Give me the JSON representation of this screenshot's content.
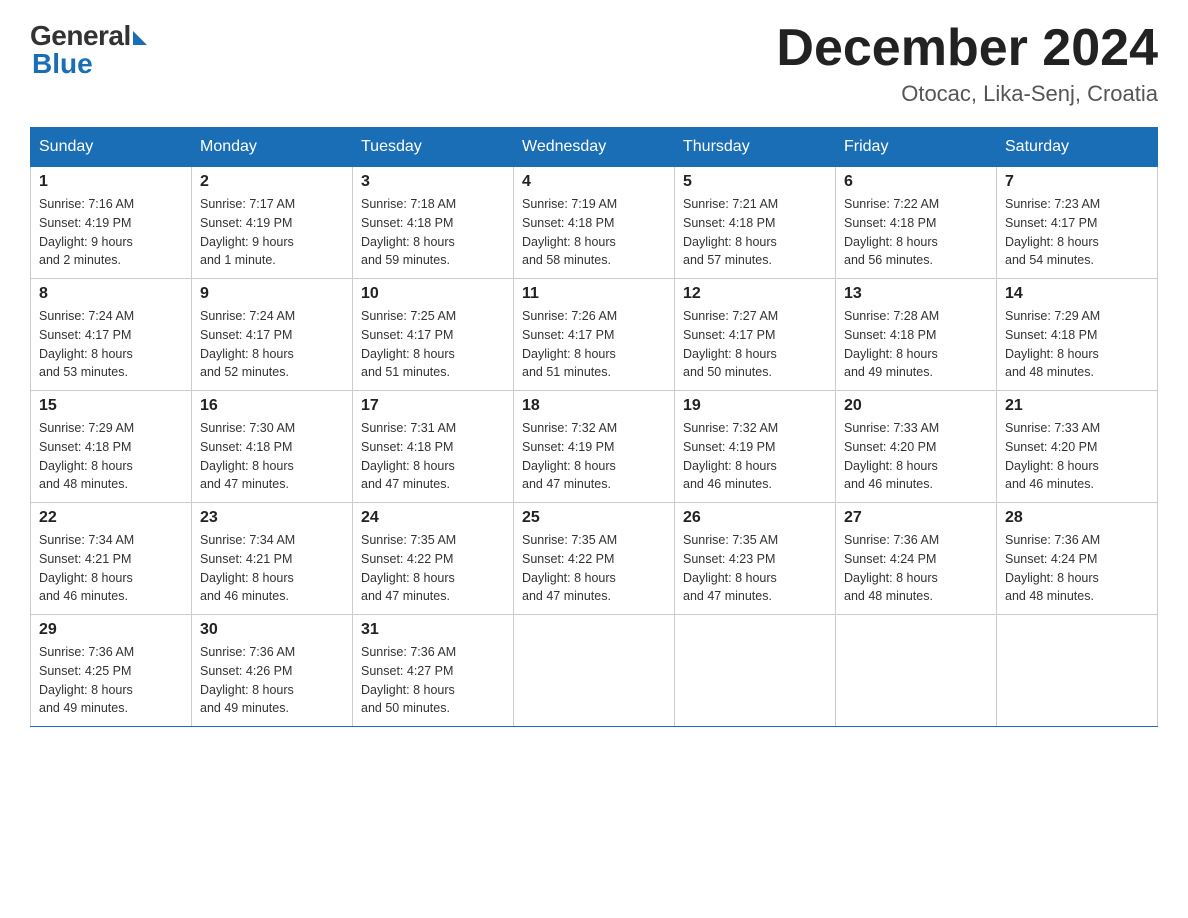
{
  "header": {
    "logo_general": "General",
    "logo_blue": "Blue",
    "title": "December 2024",
    "location": "Otocac, Lika-Senj, Croatia"
  },
  "days_of_week": [
    "Sunday",
    "Monday",
    "Tuesday",
    "Wednesday",
    "Thursday",
    "Friday",
    "Saturday"
  ],
  "weeks": [
    [
      {
        "day": "1",
        "sunrise": "7:16 AM",
        "sunset": "4:19 PM",
        "daylight": "9 hours and 2 minutes."
      },
      {
        "day": "2",
        "sunrise": "7:17 AM",
        "sunset": "4:19 PM",
        "daylight": "9 hours and 1 minute."
      },
      {
        "day": "3",
        "sunrise": "7:18 AM",
        "sunset": "4:18 PM",
        "daylight": "8 hours and 59 minutes."
      },
      {
        "day": "4",
        "sunrise": "7:19 AM",
        "sunset": "4:18 PM",
        "daylight": "8 hours and 58 minutes."
      },
      {
        "day": "5",
        "sunrise": "7:21 AM",
        "sunset": "4:18 PM",
        "daylight": "8 hours and 57 minutes."
      },
      {
        "day": "6",
        "sunrise": "7:22 AM",
        "sunset": "4:18 PM",
        "daylight": "8 hours and 56 minutes."
      },
      {
        "day": "7",
        "sunrise": "7:23 AM",
        "sunset": "4:17 PM",
        "daylight": "8 hours and 54 minutes."
      }
    ],
    [
      {
        "day": "8",
        "sunrise": "7:24 AM",
        "sunset": "4:17 PM",
        "daylight": "8 hours and 53 minutes."
      },
      {
        "day": "9",
        "sunrise": "7:24 AM",
        "sunset": "4:17 PM",
        "daylight": "8 hours and 52 minutes."
      },
      {
        "day": "10",
        "sunrise": "7:25 AM",
        "sunset": "4:17 PM",
        "daylight": "8 hours and 51 minutes."
      },
      {
        "day": "11",
        "sunrise": "7:26 AM",
        "sunset": "4:17 PM",
        "daylight": "8 hours and 51 minutes."
      },
      {
        "day": "12",
        "sunrise": "7:27 AM",
        "sunset": "4:17 PM",
        "daylight": "8 hours and 50 minutes."
      },
      {
        "day": "13",
        "sunrise": "7:28 AM",
        "sunset": "4:18 PM",
        "daylight": "8 hours and 49 minutes."
      },
      {
        "day": "14",
        "sunrise": "7:29 AM",
        "sunset": "4:18 PM",
        "daylight": "8 hours and 48 minutes."
      }
    ],
    [
      {
        "day": "15",
        "sunrise": "7:29 AM",
        "sunset": "4:18 PM",
        "daylight": "8 hours and 48 minutes."
      },
      {
        "day": "16",
        "sunrise": "7:30 AM",
        "sunset": "4:18 PM",
        "daylight": "8 hours and 47 minutes."
      },
      {
        "day": "17",
        "sunrise": "7:31 AM",
        "sunset": "4:18 PM",
        "daylight": "8 hours and 47 minutes."
      },
      {
        "day": "18",
        "sunrise": "7:32 AM",
        "sunset": "4:19 PM",
        "daylight": "8 hours and 47 minutes."
      },
      {
        "day": "19",
        "sunrise": "7:32 AM",
        "sunset": "4:19 PM",
        "daylight": "8 hours and 46 minutes."
      },
      {
        "day": "20",
        "sunrise": "7:33 AM",
        "sunset": "4:20 PM",
        "daylight": "8 hours and 46 minutes."
      },
      {
        "day": "21",
        "sunrise": "7:33 AM",
        "sunset": "4:20 PM",
        "daylight": "8 hours and 46 minutes."
      }
    ],
    [
      {
        "day": "22",
        "sunrise": "7:34 AM",
        "sunset": "4:21 PM",
        "daylight": "8 hours and 46 minutes."
      },
      {
        "day": "23",
        "sunrise": "7:34 AM",
        "sunset": "4:21 PM",
        "daylight": "8 hours and 46 minutes."
      },
      {
        "day": "24",
        "sunrise": "7:35 AM",
        "sunset": "4:22 PM",
        "daylight": "8 hours and 47 minutes."
      },
      {
        "day": "25",
        "sunrise": "7:35 AM",
        "sunset": "4:22 PM",
        "daylight": "8 hours and 47 minutes."
      },
      {
        "day": "26",
        "sunrise": "7:35 AM",
        "sunset": "4:23 PM",
        "daylight": "8 hours and 47 minutes."
      },
      {
        "day": "27",
        "sunrise": "7:36 AM",
        "sunset": "4:24 PM",
        "daylight": "8 hours and 48 minutes."
      },
      {
        "day": "28",
        "sunrise": "7:36 AM",
        "sunset": "4:24 PM",
        "daylight": "8 hours and 48 minutes."
      }
    ],
    [
      {
        "day": "29",
        "sunrise": "7:36 AM",
        "sunset": "4:25 PM",
        "daylight": "8 hours and 49 minutes."
      },
      {
        "day": "30",
        "sunrise": "7:36 AM",
        "sunset": "4:26 PM",
        "daylight": "8 hours and 49 minutes."
      },
      {
        "day": "31",
        "sunrise": "7:36 AM",
        "sunset": "4:27 PM",
        "daylight": "8 hours and 50 minutes."
      },
      null,
      null,
      null,
      null
    ]
  ]
}
